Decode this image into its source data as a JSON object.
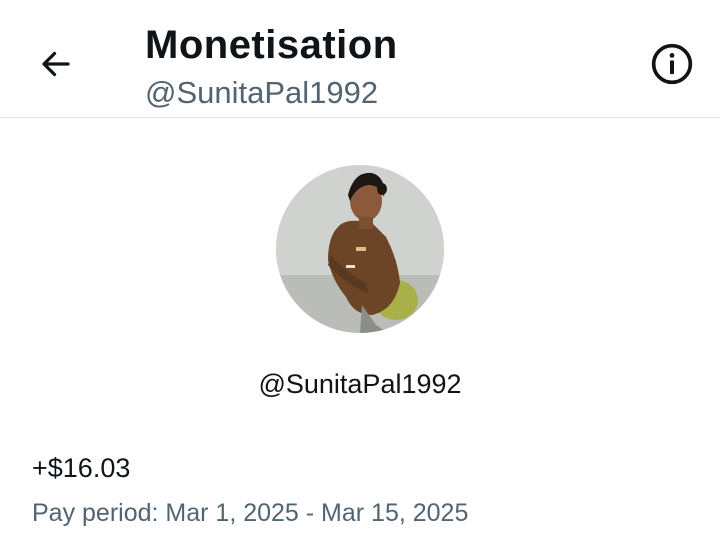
{
  "header": {
    "title": "Monetisation",
    "handle": "@SunitaPal1992",
    "back_icon": "back-arrow-icon",
    "info_icon": "info-icon"
  },
  "profile": {
    "handle": "@SunitaPal1992",
    "avatar": "profile-photo"
  },
  "earnings": {
    "amount": "+$16.03",
    "pay_period": "Pay period: Mar 1, 2025 - Mar 15, 2025"
  },
  "colors": {
    "primary_text": "#0f1419",
    "secondary_text": "#536471",
    "divider": "#e1e4e8"
  }
}
